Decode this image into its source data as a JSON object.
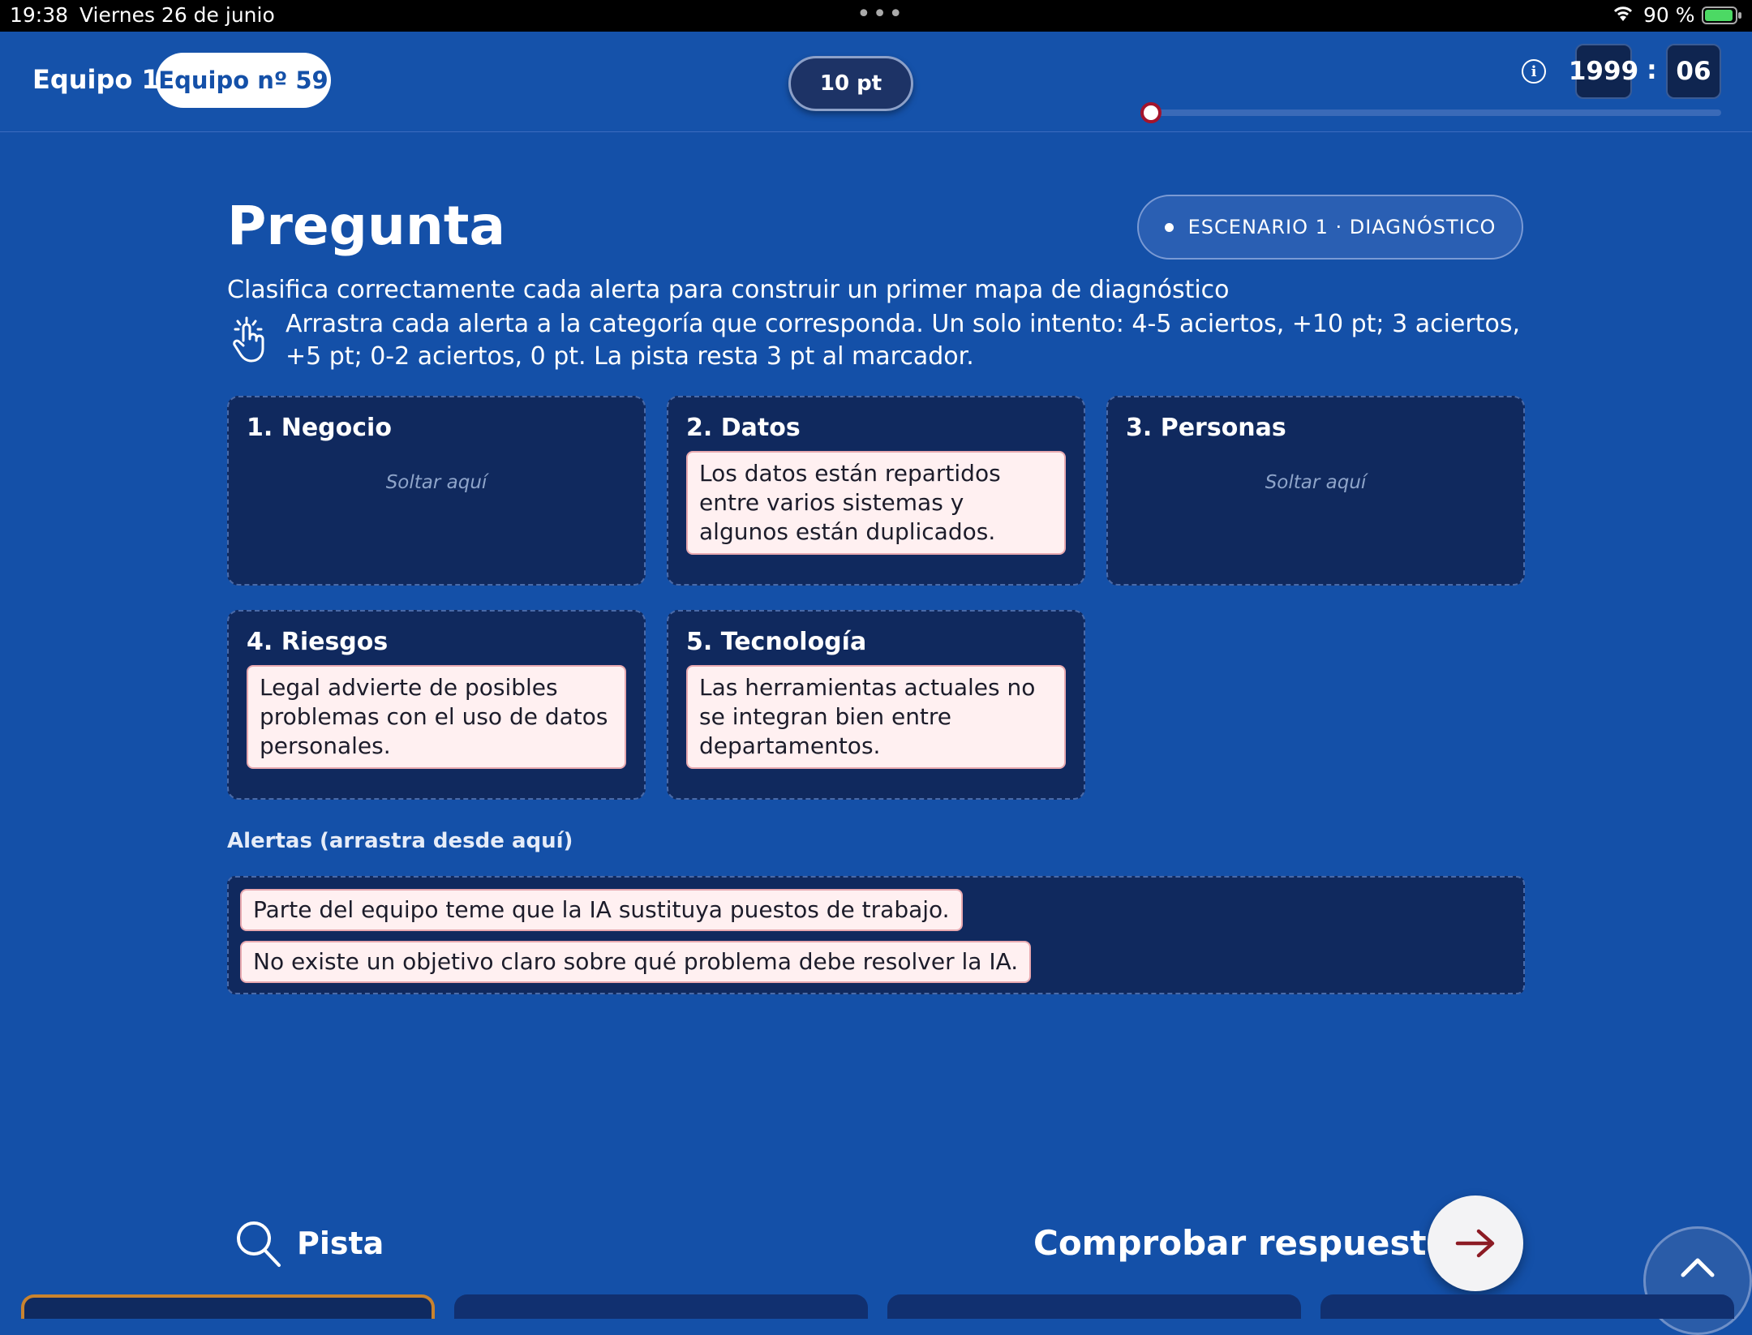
{
  "status_bar": {
    "time": "19:38",
    "date": "Viernes 26 de junio",
    "dots": "•••",
    "battery": "90 %"
  },
  "header": {
    "team_label": "Equipo 1",
    "team_pill": "Equipo nº 59",
    "score": "10 pt",
    "timer_minutes": "1999",
    "timer_separator": ":",
    "timer_seconds": "06",
    "info_icon": "i",
    "progress": 0
  },
  "question": {
    "title": "Pregunta",
    "scenario": "ESCENARIO 1 · DIAGNÓSTICO",
    "subtitle": "Clasifica correctamente cada alerta para construir un primer mapa de diagnóstico",
    "instructions": "Arrastra cada alerta a la categoría que corresponda. Un solo intento: 4-5 aciertos, +10 pt; 3 aciertos, +5 pt; 0-2 aciertos, 0 pt. La pista resta 3 pt al marcador."
  },
  "zones": [
    {
      "title": "1. Negocio",
      "empty": "Soltar aquí"
    },
    {
      "title": "2. Datos",
      "card": "Los datos están repartidos entre varios sistemas y algunos están duplicados."
    },
    {
      "title": "3. Personas",
      "empty": "Soltar aquí"
    },
    {
      "title": "4. Riesgos",
      "card": "Legal advierte de posibles problemas con el uso de datos personales."
    },
    {
      "title": "5. Tecnología",
      "card": "Las herramientas actuales no se integran bien entre departamentos."
    }
  ],
  "alerts": {
    "label": "Alertas (arrastra desde aquí)",
    "items": [
      "Parte del equipo teme que la IA sustituya puestos de trabajo.",
      "No existe un objetivo claro sobre qué problema debe resolver la IA."
    ]
  },
  "footer": {
    "hint": "Pista",
    "check": "Comprobar respuesta"
  },
  "colors": {
    "background": "#1450a8",
    "zone": "#10295e",
    "card": "#fff0f1",
    "accent": "#a3142c"
  },
  "icons": {
    "hand": "hand-tap-icon",
    "hint": "search-icon",
    "check": "arrow-right-icon",
    "scroll": "chevron-up-icon",
    "info": "info-icon"
  }
}
